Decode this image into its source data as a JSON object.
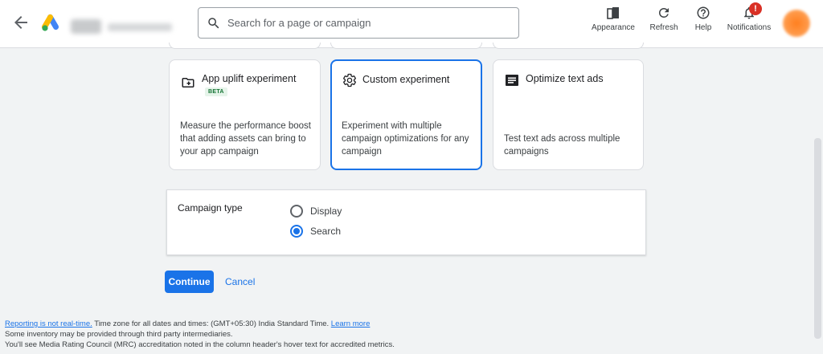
{
  "header": {
    "search_placeholder": "Search for a page or campaign",
    "tools": {
      "appearance": "Appearance",
      "refresh": "Refresh",
      "help": "Help",
      "notifications": "Notifications",
      "notifications_badge": "!"
    }
  },
  "cards": [
    {
      "title": "App uplift experiment",
      "badge": "BETA",
      "description": "Measure the performance boost that adding assets can bring to your app campaign",
      "icon": "folder-add-icon"
    },
    {
      "title": "Custom experiment",
      "description": "Experiment with multiple campaign optimizations for any campaign",
      "icon": "gear-icon",
      "selected": true
    },
    {
      "title": "Optimize text ads",
      "description": "Test text ads across multiple campaigns",
      "icon": "text-ad-icon"
    }
  ],
  "campaign_type": {
    "label": "Campaign type",
    "options": [
      "Display",
      "Search"
    ],
    "selected": "Search"
  },
  "actions": {
    "continue": "Continue",
    "cancel": "Cancel"
  },
  "footer": {
    "reporting_link": "Reporting is not real-time.",
    "timezone_text": " Time zone for all dates and times: (GMT+05:30) India Standard Time. ",
    "learn_more": "Learn more",
    "line2": "Some inventory may be provided through third party intermediaries.",
    "line3": "You'll see Media Rating Council (MRC) accreditation noted in the column header's hover text for accredited metrics."
  },
  "colors": {
    "accent": "#1a73e8",
    "notification_badge": "#d93025"
  }
}
